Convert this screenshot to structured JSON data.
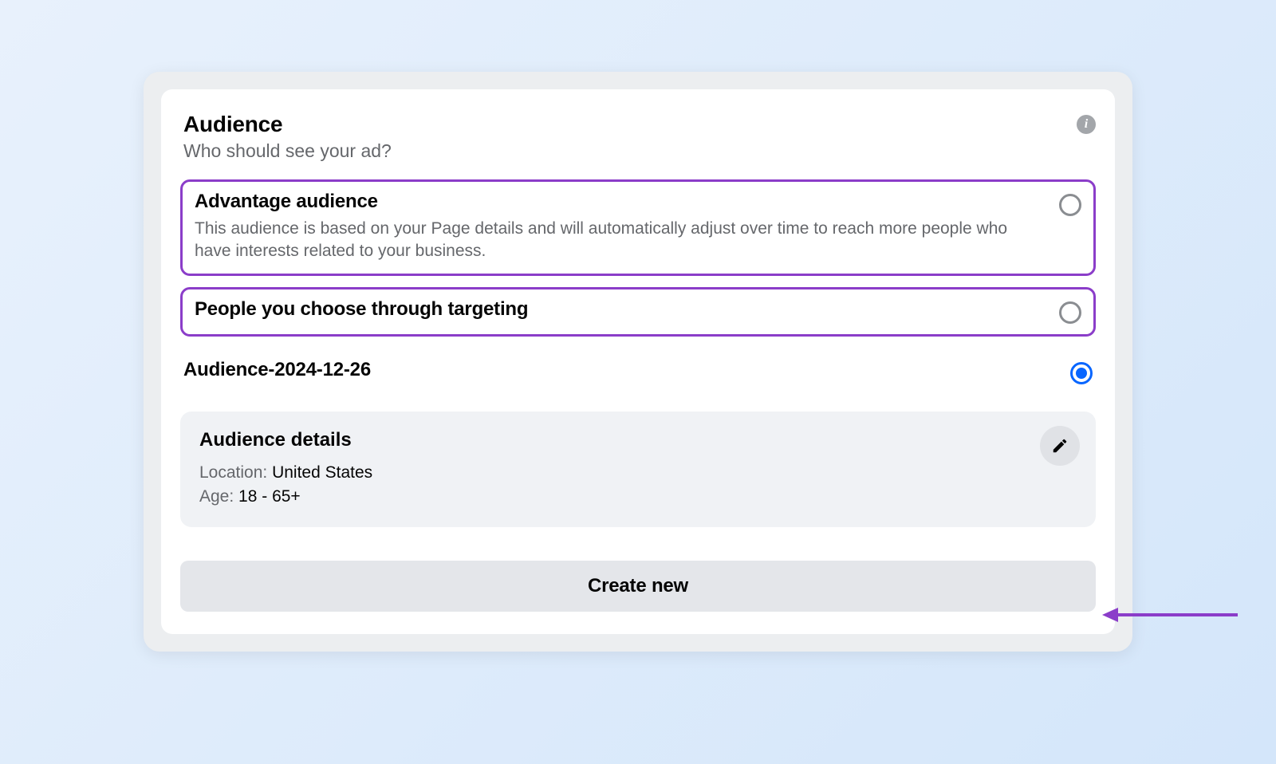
{
  "colors": {
    "highlight": "#8b3dc9",
    "primary": "#0866ff"
  },
  "header": {
    "title": "Audience",
    "subtitle": "Who should see your ad?"
  },
  "options": [
    {
      "id": "advantage",
      "title": "Advantage audience",
      "description": "This audience is based on your Page details and will automatically adjust over time to reach more people who have interests related to your business.",
      "selected": false,
      "highlighted": true
    },
    {
      "id": "targeting",
      "title": "People you choose through targeting",
      "description": "",
      "selected": false,
      "highlighted": true
    },
    {
      "id": "saved",
      "title": "Audience-2024-12-26",
      "description": "",
      "selected": true,
      "highlighted": false
    }
  ],
  "details": {
    "title": "Audience details",
    "location_label": "Location:",
    "location_value": "United States",
    "age_label": "Age:",
    "age_value": "18 - 65+"
  },
  "create_button_label": "Create new"
}
